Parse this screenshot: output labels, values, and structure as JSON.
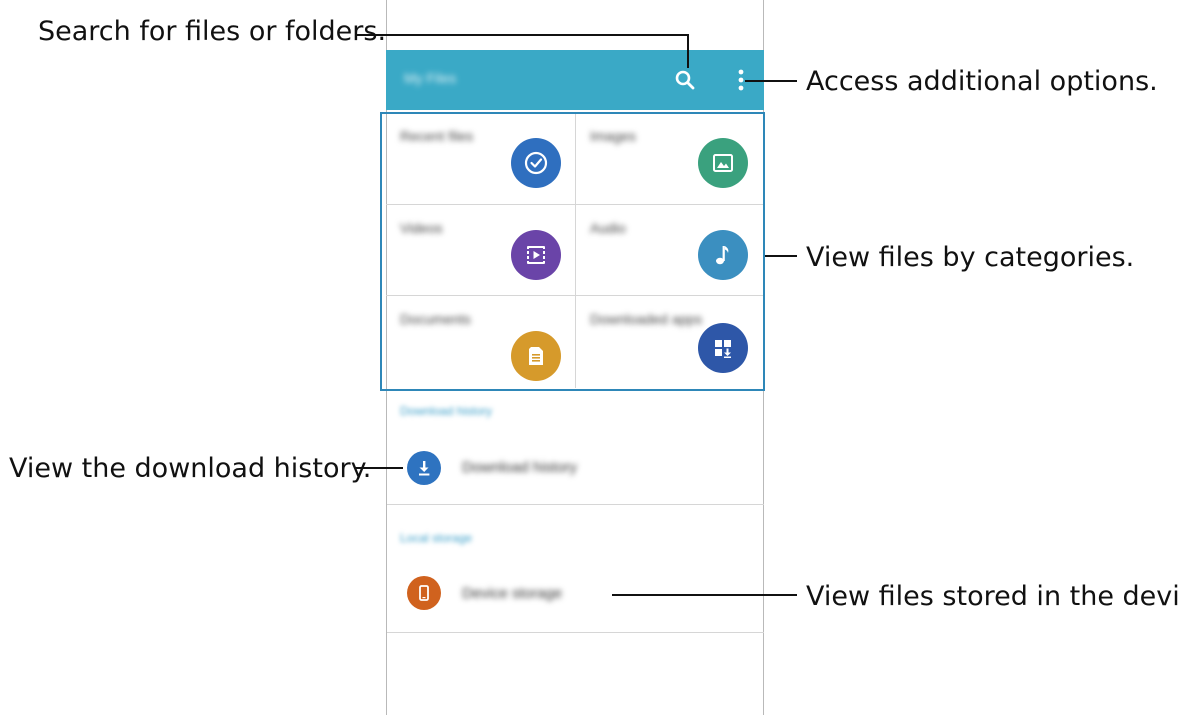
{
  "annotations": {
    "search": "Search for files or folders.",
    "options": "Access additional options.",
    "categories": "View files by categories.",
    "download_history": "View the download history.",
    "device": "View files stored in the device."
  },
  "appbar": {
    "title": "My Files"
  },
  "categories": [
    {
      "label": "Recent files",
      "icon": "clock-icon",
      "color": "#2f6fbf"
    },
    {
      "label": "Images",
      "icon": "image-icon",
      "color": "#3aa17e"
    },
    {
      "label": "Videos",
      "icon": "video-icon",
      "color": "#6a44a8"
    },
    {
      "label": "Audio",
      "icon": "music-icon",
      "color": "#3b8fc0"
    },
    {
      "label": "Documents",
      "icon": "document-icon",
      "color": "#d69a2b"
    },
    {
      "label": "Downloaded apps",
      "icon": "download-apps-icon",
      "color": "#2e57a8"
    }
  ],
  "sections": {
    "download_history_header": "Download history",
    "download_history_item": "Download history",
    "local_storage_header": "Local storage",
    "device_storage_item": "Device storage"
  },
  "colors": {
    "appbar": "#3aa9c6",
    "highlight": "#2e87b8",
    "download": "#2e73c0",
    "device": "#d0621e"
  }
}
